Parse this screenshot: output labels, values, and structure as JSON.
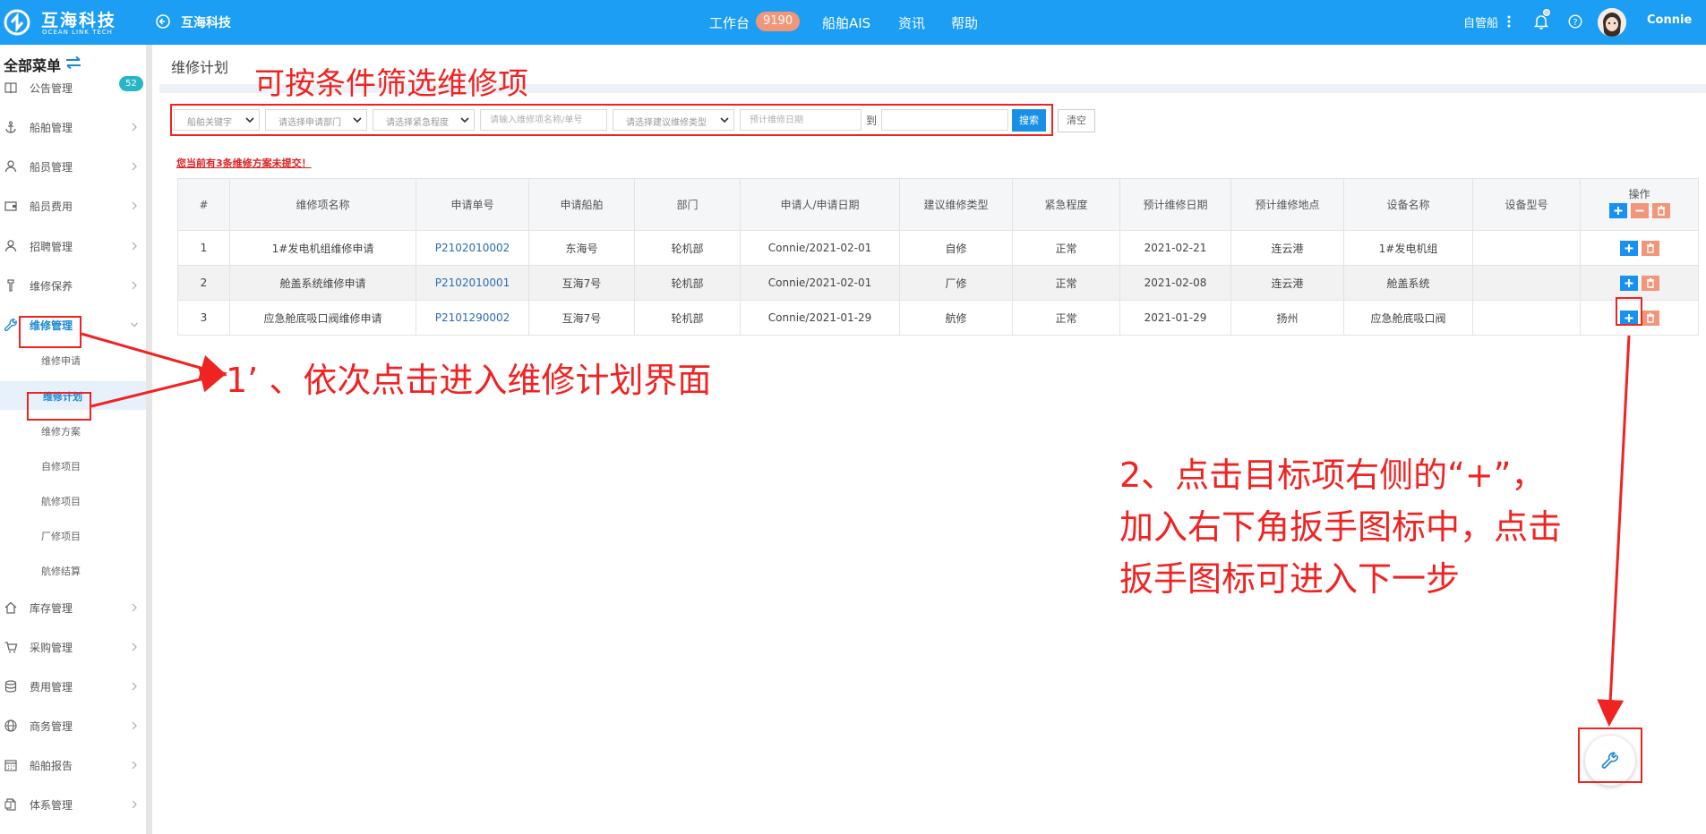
{
  "header": {
    "logo_cn": "互海科技",
    "logo_en": "OCEAN LINK TECH",
    "back_label": "互海科技",
    "nav": [
      {
        "label": "工作台",
        "badge": "9190"
      },
      {
        "label": "船舶AIS"
      },
      {
        "label": "资讯"
      },
      {
        "label": "帮助"
      }
    ],
    "ship_mode": "自管船",
    "user": "Connie",
    "colors": {
      "bar": "#1b9ef3",
      "badge": "#f2967a"
    }
  },
  "sidebar": {
    "title": "全部菜单",
    "items": [
      {
        "label": "公告管理",
        "icon": "book-icon",
        "badge": "52"
      },
      {
        "label": "船舶管理",
        "icon": "anchor-icon"
      },
      {
        "label": "船员管理",
        "icon": "person-icon"
      },
      {
        "label": "船员费用",
        "icon": "wallet-icon"
      },
      {
        "label": "招聘管理",
        "icon": "person-icon"
      },
      {
        "label": "维修保养",
        "icon": "tool-icon"
      },
      {
        "label": "维修管理",
        "icon": "wrench-icon",
        "active": true
      },
      {
        "label": "库存管理",
        "icon": "house-icon"
      },
      {
        "label": "采购管理",
        "icon": "cart-icon"
      },
      {
        "label": "费用管理",
        "icon": "database-icon"
      },
      {
        "label": "商务管理",
        "icon": "globe-icon"
      },
      {
        "label": "船舶报告",
        "icon": "calendar-icon"
      },
      {
        "label": "体系管理",
        "icon": "document-icon"
      }
    ],
    "subitems": [
      {
        "label": "维修申请"
      },
      {
        "label": "维修计划",
        "active": true
      },
      {
        "label": "维修方案"
      },
      {
        "label": "自修项目"
      },
      {
        "label": "航修项目"
      },
      {
        "label": "厂修项目"
      },
      {
        "label": "航修结算"
      }
    ]
  },
  "page": {
    "title": "维修计划",
    "filters": {
      "ship_keyword": "船舶关键字",
      "dept": "请选择申请部门",
      "urgency": "请选择紧急程度",
      "name_placeholder": "请输入维修项名称/单号",
      "type": "请选择建议维修类型",
      "date_placeholder": "预计维修日期",
      "to": "到",
      "search": "搜索",
      "clear": "清空"
    },
    "warning": "您当前有3条维修方案未提交！",
    "table": {
      "columns": [
        "#",
        "维修项名称",
        "申请单号",
        "申请船舶",
        "部门",
        "申请人/申请日期",
        "建议维修类型",
        "紧急程度",
        "预计维修日期",
        "预计维修地点",
        "设备名称",
        "设备型号",
        "操作"
      ],
      "rows": [
        [
          "1",
          "1#发电机组维修申请",
          "P2102010002",
          "东海号",
          "轮机部",
          "Connie/2021-02-01",
          "自修",
          "正常",
          "2021-02-21",
          "连云港",
          "1#发电机组",
          ""
        ],
        [
          "2",
          "舱盖系统维修申请",
          "P2102010001",
          "互海7号",
          "轮机部",
          "Connie/2021-02-01",
          "厂修",
          "正常",
          "2021-02-08",
          "连云港",
          "舱盖系统",
          ""
        ],
        [
          "3",
          "应急舱底吸口阀维修申请",
          "P2101290002",
          "互海7号",
          "轮机部",
          "Connie/2021-01-29",
          "航修",
          "正常",
          "2021-01-29",
          "扬州",
          "应急舱底吸口阀",
          ""
        ]
      ]
    }
  },
  "annotations": {
    "filter_note": "可按条件筛选维修项",
    "step1": "1’ 、依次点击进入维修计划界面",
    "step2_lines": [
      "2、点击目标项右侧的“+”，",
      "加入右下角扳手图标中，点击",
      "扳手图标可进入下一步"
    ],
    "color": "#f02323"
  }
}
